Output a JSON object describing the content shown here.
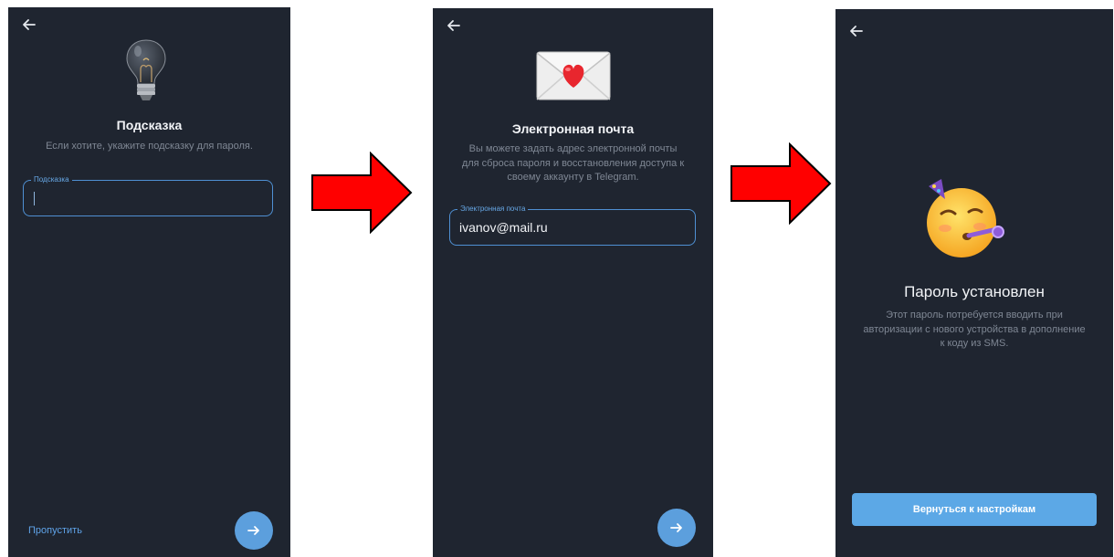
{
  "screens": {
    "hint": {
      "title": "Подсказка",
      "description": "Если хотите, укажите подсказку для пароля.",
      "field_label": "Подсказка",
      "field_value": "",
      "skip_label": "Пропустить",
      "icon": "lightbulb-icon"
    },
    "email": {
      "title": "Электронная почта",
      "description_lines": [
        "Вы можете задать адрес электронной почты",
        "для сброса пароля и восстановления доступа к",
        "своему аккаунту в Telegram."
      ],
      "field_label": "Электронная почта",
      "field_value": "ivanov@mail.ru",
      "icon": "love-letter-icon"
    },
    "done": {
      "title": "Пароль установлен",
      "description_lines": [
        "Этот пароль потребуется вводить при",
        "авторизации с нового устройства в дополнение",
        "к коду из SMS."
      ],
      "button_label": "Вернуться к настройкам",
      "icon": "party-face-icon"
    }
  },
  "colors": {
    "screen_bg": "#1f2530",
    "accent": "#5c9fdd",
    "arrow": "#ff0000"
  }
}
